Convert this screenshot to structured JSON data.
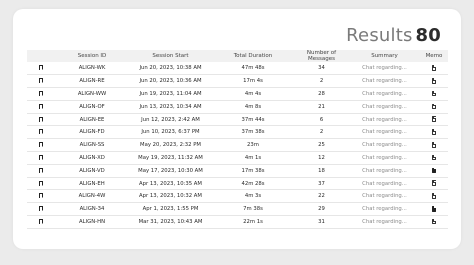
{
  "results": {
    "label": "Results",
    "count": "80"
  },
  "table": {
    "headers": {
      "bookmark": "",
      "session_id": "Session ID",
      "session_start": "Session Start",
      "total_duration": "Total Duration",
      "num_messages": "Number of Messages",
      "summary": "Summary",
      "memo": "Memo"
    },
    "rows": [
      {
        "session_id": "ALIGN-WK",
        "session_start": "Jun 20, 2023, 10:38 AM",
        "total_duration": "47m 48s",
        "num_messages": "34",
        "summary": "Chat regarding...",
        "memo_icon": "document-outline-icon"
      },
      {
        "session_id": "ALIGN-RE",
        "session_start": "Jun 20, 2023, 10:36 AM",
        "total_duration": "17m 4s",
        "num_messages": "2",
        "summary": "Chat regarding...",
        "memo_icon": "document-outline-icon"
      },
      {
        "session_id": "ALIGN-WW",
        "session_start": "Jun 19, 2023, 11:04 AM",
        "total_duration": "4m 4s",
        "num_messages": "28",
        "summary": "Chat regarding...",
        "memo_icon": "document-outline-icon"
      },
      {
        "session_id": "ALIGN-OF",
        "session_start": "Jun 13, 2023, 10:34 AM",
        "total_duration": "4m 8s",
        "num_messages": "21",
        "summary": "Chat regarding...",
        "memo_icon": "document-outline-icon"
      },
      {
        "session_id": "ALIGN-EE",
        "session_start": "Jun 12, 2023, 2:42 AM",
        "total_duration": "37m 44s",
        "num_messages": "6",
        "summary": "Chat regarding...",
        "memo_icon": "document-outline-icon"
      },
      {
        "session_id": "ALIGN-FD",
        "session_start": "Jun 10, 2023, 6:37 PM",
        "total_duration": "37m 38s",
        "num_messages": "2",
        "summary": "Chat regarding...",
        "memo_icon": "document-outline-icon"
      },
      {
        "session_id": "ALIGN-SS",
        "session_start": "May 20, 2023, 2:32 PM",
        "total_duration": "23m",
        "num_messages": "25",
        "summary": "Chat regarding...",
        "memo_icon": "document-outline-icon"
      },
      {
        "session_id": "ALIGN-XD",
        "session_start": "May 19, 2023, 11:32 AM",
        "total_duration": "4m 1s",
        "num_messages": "12",
        "summary": "Chat regarding...",
        "memo_icon": "document-outline-icon"
      },
      {
        "session_id": "ALIGN-VD",
        "session_start": "May 17, 2023, 10:30 AM",
        "total_duration": "17m 38s",
        "num_messages": "18",
        "summary": "Chat regarding...",
        "memo_icon": "document-filled-icon"
      },
      {
        "session_id": "ALIGN-EH",
        "session_start": "Apr 13, 2023, 10:35 AM",
        "total_duration": "42m 28s",
        "num_messages": "37",
        "summary": "Chat regarding...",
        "memo_icon": "document-outline-icon"
      },
      {
        "session_id": "ALIGN-4W",
        "session_start": "Apr 13, 2023, 10:32 AM",
        "total_duration": "4m 3s",
        "num_messages": "22",
        "summary": "Chat regarding...",
        "memo_icon": "document-outline-icon"
      },
      {
        "session_id": "ALIGN-34",
        "session_start": "Apr 1, 2023, 1:55 PM",
        "total_duration": "7m 38s",
        "num_messages": "29",
        "summary": "Chat regarding...",
        "memo_icon": "document-filled-icon"
      },
      {
        "session_id": "ALIGN-HN",
        "session_start": "Mar 31, 2023, 10:43 AM",
        "total_duration": "22m 1s",
        "num_messages": "31",
        "summary": "Chat regarding...",
        "memo_icon": "document-outline-icon"
      }
    ]
  }
}
